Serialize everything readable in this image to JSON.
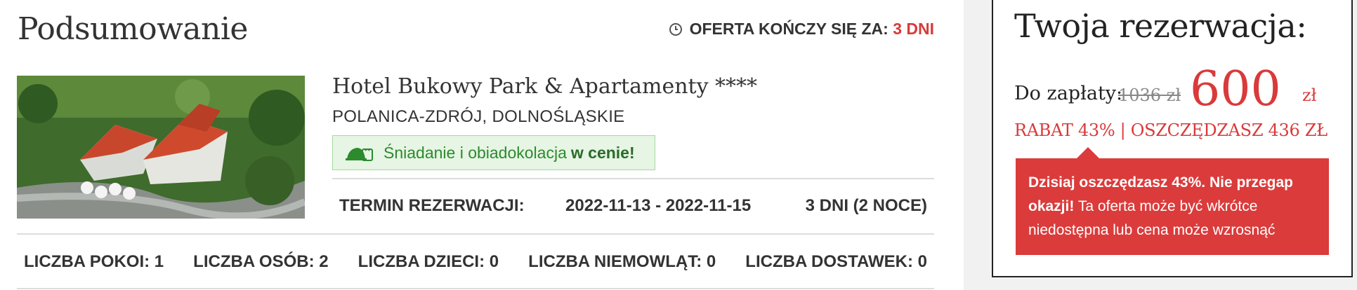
{
  "summary": {
    "title": "Podsumowanie",
    "offer_label": "OFERTA KOŃCZY SIĘ ZA:",
    "offer_days": "3 DNI"
  },
  "hotel": {
    "name": "Hotel Bukowy Park & Apartamenty ****",
    "location": "POLANICA-ZDRÓJ, DOLNOŚLĄSKIE",
    "meal_text": "Śniadanie i obiadokolacja",
    "meal_emphasis": "w cenie!"
  },
  "term": {
    "label": "TERMIN REZERWACJI:",
    "dates": "2022-11-13 - 2022-11-15",
    "nights": "3 DNI (2 NOCE)"
  },
  "counts": {
    "rooms": "LICZBA POKOI: 1",
    "persons": "LICZBA OSÓB: 2",
    "children": "LICZBA DZIECI: 0",
    "infants": "LICZBA NIEMOWLĄT: 0",
    "extra_beds": "LICZBA DOSTAWEK: 0"
  },
  "reservation": {
    "title": "Twoja rezerwacja:",
    "pay_label": "Do zapłaty:",
    "old_price": "1036 zł",
    "new_price": "600",
    "currency": "zł",
    "discount": "RABAT 43% | OSZCZĘDZASZ 436 ZŁ",
    "alert_bold": "Dzisiaj oszczędzasz 43%. Nie przegap okazji!",
    "alert_text": " Ta oferta może być wkrótce niedostępna lub cena może wzrosnąć"
  },
  "colors": {
    "accent_red": "#d93a3a",
    "meal_green": "#2d8a2d",
    "meal_bg": "#e6f5e4"
  },
  "icons": {
    "clock": "clock-icon",
    "meal": "meal-icon",
    "photo": "hotel-photo"
  }
}
